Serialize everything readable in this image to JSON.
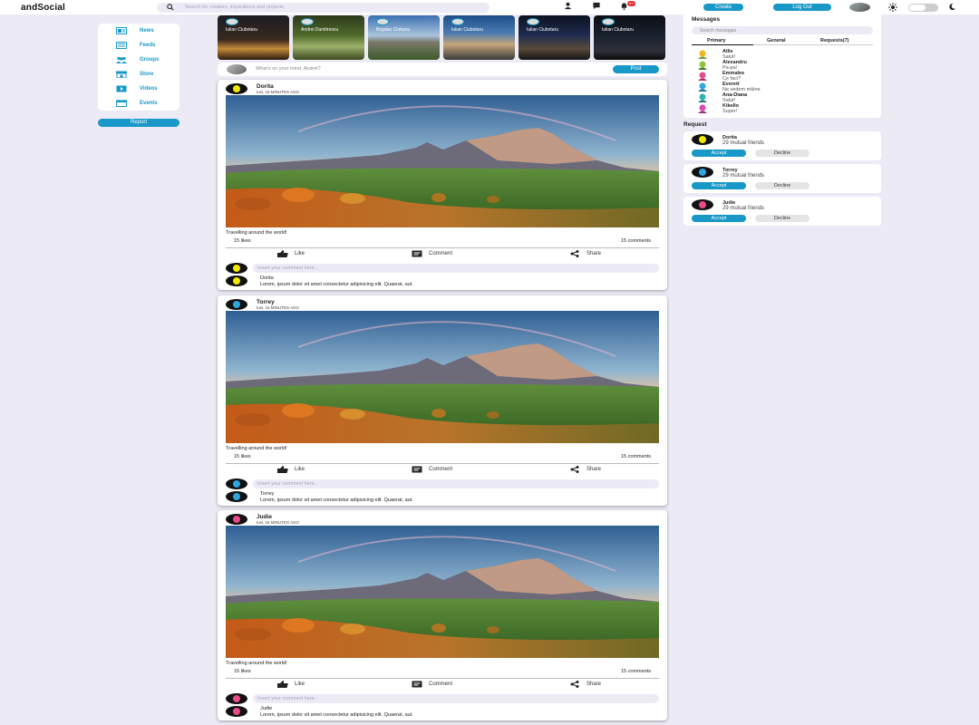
{
  "header": {
    "logo": "andSocial",
    "search_placeholder": "Search for creators, inspirations and projects",
    "notification_count": "9+",
    "create_label": "Create",
    "logout_label": "Log Out"
  },
  "sidebar": {
    "items": [
      {
        "label": "News",
        "icon": "news-icon"
      },
      {
        "label": "Feeds",
        "icon": "feeds-icon"
      },
      {
        "label": "Groups",
        "icon": "groups-icon"
      },
      {
        "label": "Store",
        "icon": "store-icon"
      },
      {
        "label": "Videos",
        "icon": "videos-icon"
      },
      {
        "label": "Events",
        "icon": "events-icon"
      }
    ],
    "report_label": "Report"
  },
  "stories": [
    {
      "name": "Iulian Ciubotaru"
    },
    {
      "name": "Andrei Dumitrescu"
    },
    {
      "name": "Bogdan Ciobanu"
    },
    {
      "name": "Iulian Ciubotaru"
    },
    {
      "name": "Iulian Ciubotaru"
    },
    {
      "name": "Iulian Ciubotaru"
    }
  ],
  "composer": {
    "placeholder": "What's on your mind, Andrei?",
    "post_label": "Post"
  },
  "posts": [
    {
      "author": "Dorita",
      "time": "tusi, 15 MINUTES AGO",
      "caption": "Travelling around the world!",
      "likes": "15 likes",
      "comments": "15 comments",
      "like_label": "Like",
      "comment_label": "Comment",
      "share_label": "Share",
      "comment_placeholder": "Insert your comment here...",
      "comment_author": "Dorita",
      "comment_text": "Lorem, ipsum dolor sit amet consectetur adipisicing elit. Quaerat, aut.",
      "accent": "#f5e800"
    },
    {
      "author": "Torrey",
      "time": "tusi, 15 MINUTES AGO",
      "caption": "Travelling around the world!",
      "likes": "15 likes",
      "comments": "15 comments",
      "like_label": "Like",
      "comment_label": "Comment",
      "share_label": "Share",
      "comment_placeholder": "Insert your comment here...",
      "comment_author": "Torrey",
      "comment_text": "Lorem, ipsum dolor sit amet consectetur adipisicing elit. Quaerat, aut.",
      "accent": "#2ea6e0"
    },
    {
      "author": "Judie",
      "time": "tusi, 15 MINUTES AGO",
      "caption": "Travelling around the world!",
      "likes": "15 likes",
      "comments": "15 comments",
      "like_label": "Like",
      "comment_label": "Comment",
      "share_label": "Share",
      "comment_placeholder": "Insert your comment here...",
      "comment_author": "Judie",
      "comment_text": "Lorem, ipsum dolor sit amet consectetur adipisicing elit. Quaerat, aut.",
      "accent": "#e84a8a"
    }
  ],
  "messages": {
    "title": "Messages",
    "search_placeholder": "Search messages",
    "tabs": [
      "Primary",
      "General",
      "Requests(7)"
    ],
    "items": [
      {
        "name": "Allis",
        "text": "Salut!"
      },
      {
        "name": "Alexandru",
        "text": "Pa-pa!"
      },
      {
        "name": "Emmalee",
        "text": "Ce faci?"
      },
      {
        "name": "Everett",
        "text": "Ne vedem mâine"
      },
      {
        "name": "Ana-Diana",
        "text": "Salut!"
      },
      {
        "name": "Kikello",
        "text": "Super!"
      }
    ]
  },
  "requests": {
    "title": "Request",
    "items": [
      {
        "name": "Dorita",
        "mutual": "29 mutual friends",
        "accept": "Accept",
        "decline": "Decline"
      },
      {
        "name": "Torrey",
        "mutual": "29 mutual friends",
        "accept": "Accept",
        "decline": "Decline"
      },
      {
        "name": "Judie",
        "mutual": "29 mutual friends",
        "accept": "Accept",
        "decline": "Decline"
      }
    ]
  },
  "colors": {
    "accent": "#1798c7",
    "background": "#ecebf5",
    "notification": "#e53030"
  }
}
